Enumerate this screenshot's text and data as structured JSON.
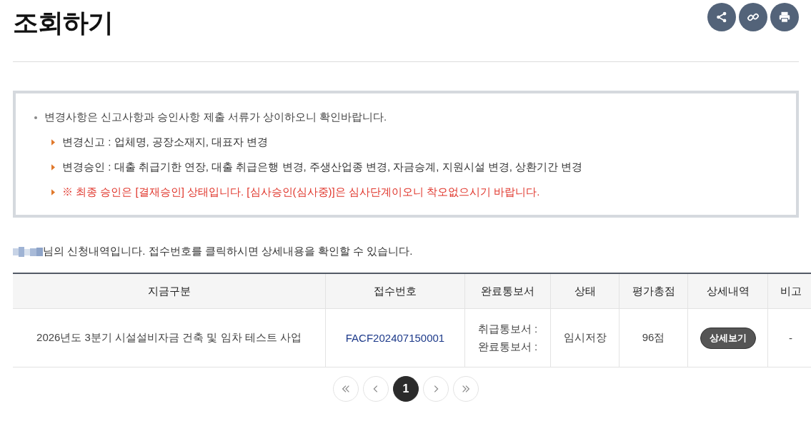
{
  "page_title": "조회하기",
  "header_actions": [
    {
      "kind": "share"
    },
    {
      "kind": "link"
    },
    {
      "kind": "print"
    }
  ],
  "notice": {
    "heading": "변경사항은 신고사항과 승인사항 제출 서류가 상이하오니 확인바랍니다.",
    "items": [
      {
        "kind": "note",
        "text": "변경신고 : 업체명, 공장소재지, 대표자 변경"
      },
      {
        "kind": "note",
        "text": "변경승인 : 대출 취급기한 연장, 대출 취급은행 변경, 주생산업종 변경, 자금승계, 지원시설 변경, 상환기간 변경"
      },
      {
        "kind": "warning",
        "text": "※ 최종 승인은 [결재승인] 상태입니다. [심사승인(심사중)]은 심사단계이오니 착오없으시기 바랍니다."
      }
    ]
  },
  "intro_text": "님의 신청내역입니다. 접수번호를 클릭하시면 상세내용을 확인할 수 있습니다.",
  "table": {
    "columns": [
      "지금구분",
      "접수번호",
      "완료통보서",
      "상태",
      "평가총점",
      "상세내역",
      "비고"
    ],
    "rows": [
      {
        "category": "2026년도 3분기 시설설비자금 건축 및 임차 테스트 사업",
        "receipt_no": "FACF202407150001",
        "reports": [
          "취급통보서 :",
          "완료통보서 :"
        ],
        "status": "임시저장",
        "score": "96점",
        "detail_button": "상세보기",
        "note": "-"
      }
    ]
  },
  "pagination": {
    "nav": [
      {
        "kind": "first"
      },
      {
        "kind": "prev"
      }
    ],
    "pages": [
      {
        "label": "1",
        "selected": true
      }
    ],
    "nav_after": [
      {
        "kind": "next"
      },
      {
        "kind": "last"
      }
    ]
  }
}
